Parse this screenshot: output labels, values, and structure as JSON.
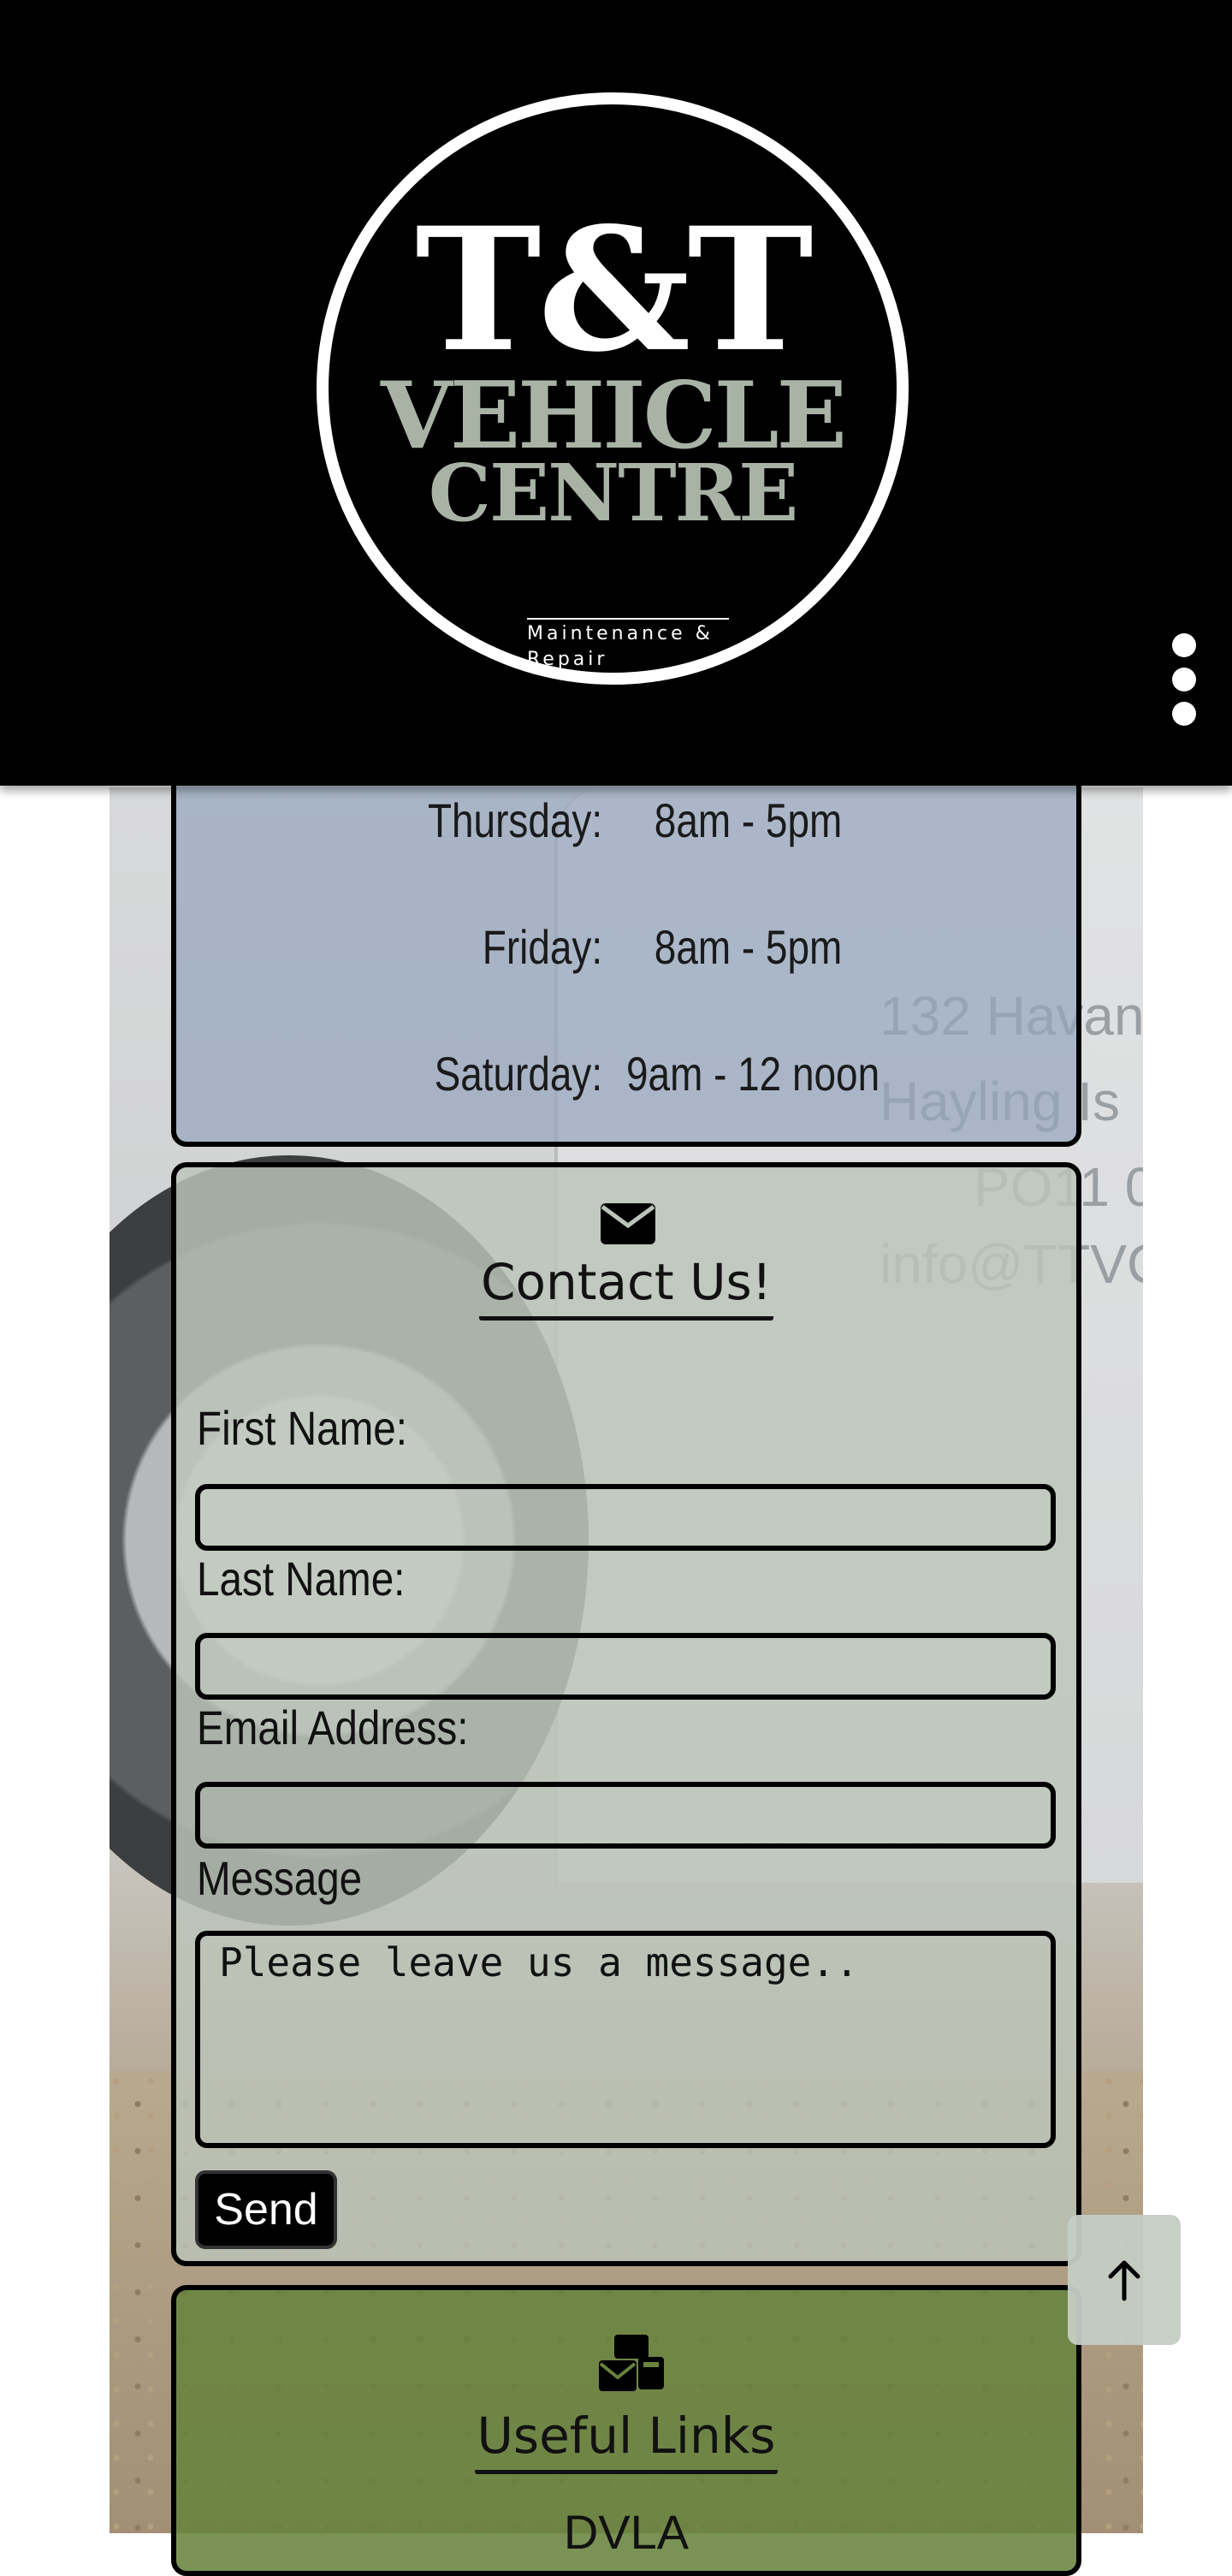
{
  "header": {
    "logo": {
      "line1": "T&T",
      "line2": "VEHICLE",
      "line3": "CENTRE",
      "tagline": "Maintenance & Repair"
    },
    "menu_icon": "more-vertical-icon"
  },
  "background": {
    "van_text_lines": [
      "132 Havant",
      "Hayling Is",
      "PO11 0",
      "info@TTVC"
    ]
  },
  "opening_hours": {
    "rows": [
      {
        "day": "Thursday:",
        "time": "8am - 5pm"
      },
      {
        "day": "Friday:",
        "time": "8am - 5pm"
      },
      {
        "day": "Saturday:",
        "time": "9am - 12 noon"
      }
    ]
  },
  "contact": {
    "icon": "envelope-icon",
    "title": "Contact Us!",
    "first_name_label": "First Name:",
    "last_name_label": "Last Name:",
    "email_label": "Email Address:",
    "message_label": "Message",
    "first_name_value": "",
    "last_name_value": "",
    "email_value": "",
    "message_placeholder": "Please leave us a message..",
    "send_label": "Send"
  },
  "useful_links": {
    "icon": "mail-bulk-icon",
    "title": "Useful Links",
    "first_item": "DVLA"
  },
  "back_to_top": {
    "icon": "arrow-up-icon"
  },
  "colors": {
    "header_bg": "#000000",
    "logo_accent": "#a8b3a6",
    "hours_card_bg": "#96a6be",
    "contact_card_bg": "#bcc4ba",
    "links_card_bg": "#68833e",
    "button_bg": "#000000"
  }
}
